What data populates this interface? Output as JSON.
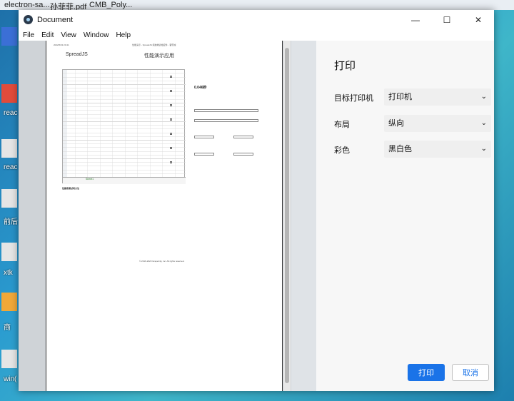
{
  "desktop": {
    "taskbar_items": [
      "electron-sa...",
      "孙菲菲.pdf",
      "CMB_Poly..."
    ],
    "icons": [
      "reac",
      "reac",
      "前后",
      "xtk",
      "商",
      "win("
    ]
  },
  "window": {
    "title": "Document",
    "controls": {
      "minimize": "—",
      "maximize": "☐",
      "close": "✕"
    },
    "menu": [
      "File",
      "Edit",
      "View",
      "Window",
      "Help"
    ]
  },
  "preview": {
    "logo": "SpreadJS",
    "title": "性能演示应用",
    "date": "2022/5/23 20:41",
    "header_text": "性能演示 - SpreadJS 纯前端表格控件 - 葡萄城",
    "sheet_tab": "Sheet1",
    "right_panel": {
      "elapsed_time": "0.046秒",
      "buttons": [
        "导出",
        "导出PDF",
        "导出",
        "打印"
      ]
    },
    "footer_heading": "性能表测试项方法",
    "footer_copyright": "© 2016-2020 GrapeCity, inc. All rights reserved."
  },
  "print_settings": {
    "title": "打印",
    "rows": [
      {
        "label": "目标打印机",
        "value": "打印机"
      },
      {
        "label": "布局",
        "value": "纵向"
      },
      {
        "label": "彩色",
        "value": "黑白色"
      }
    ],
    "print_button": "打印",
    "cancel_button": "取消"
  }
}
